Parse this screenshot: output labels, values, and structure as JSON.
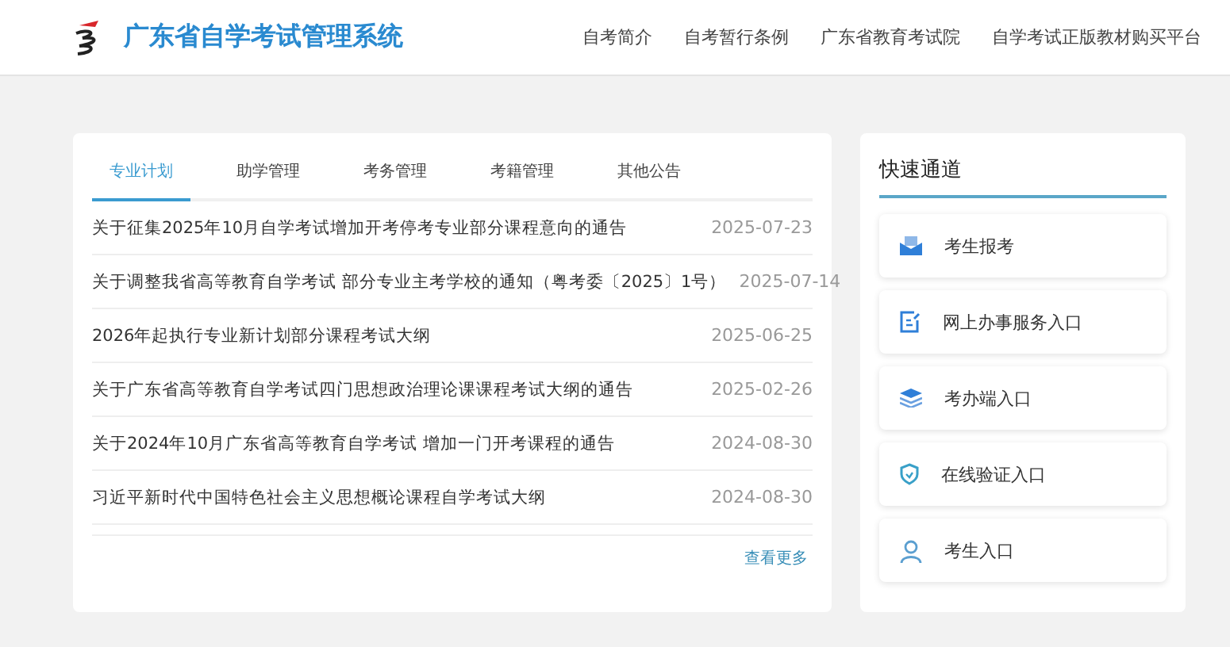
{
  "header": {
    "title": "广东省自学考试管理系统",
    "nav": [
      "自考简介",
      "自考暂行条例",
      "广东省教育考试院",
      "自学考试正版教材购买平台"
    ]
  },
  "news": {
    "tabs": [
      {
        "label": "专业计划",
        "selected": true
      },
      {
        "label": "助学管理",
        "selected": false
      },
      {
        "label": "考务管理",
        "selected": false
      },
      {
        "label": "考籍管理",
        "selected": false
      },
      {
        "label": "其他公告",
        "selected": false
      }
    ],
    "rows": [
      {
        "title": "关于征集2025年10月自学考试增加开考停考专业部分课程意向的通告",
        "date": "2025-07-23"
      },
      {
        "title": "关于调整我省高等教育自学考试 部分专业主考学校的通知（粤考委〔2025〕1号）",
        "date": "2025-07-14"
      },
      {
        "title": "2026年起执行专业新计划部分课程考试大纲",
        "date": "2025-06-25"
      },
      {
        "title": "关于广东省高等教育自学考试四门思想政治理论课课程考试大纲的通告",
        "date": "2025-02-26"
      },
      {
        "title": "关于2024年10月广东省高等教育自学考试 增加一门开考课程的通告",
        "date": "2024-08-30"
      },
      {
        "title": "习近平新时代中国特色社会主义思想概论课程自学考试大纲",
        "date": "2024-08-30"
      }
    ],
    "more": "查看更多"
  },
  "quick": {
    "title": "快速通道",
    "links": [
      "考生报考",
      "网上办事服务入口",
      "考办端入口",
      "在线验证入口",
      "考生入口"
    ]
  }
}
